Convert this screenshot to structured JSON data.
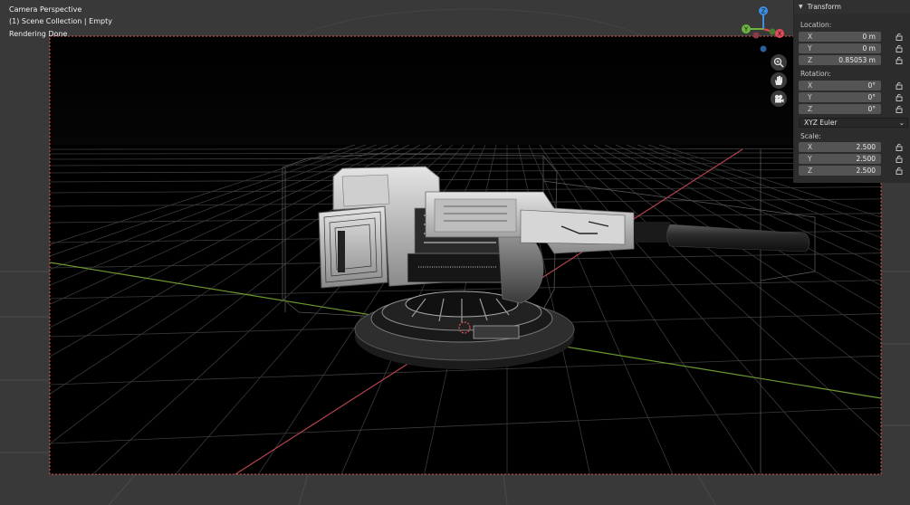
{
  "overlay": {
    "view_name": "Camera Perspective",
    "collection": "(1) Scene Collection | Empty",
    "status": "Rendering Done"
  },
  "gizmo": {
    "axes": [
      "Z",
      "Y",
      "X"
    ],
    "colors": {
      "x": "#e04b5a",
      "y": "#6db33f",
      "z": "#3d8fe0"
    }
  },
  "nav_icons": [
    "zoom-icon",
    "hand-pan-icon",
    "camera-view-icon"
  ],
  "transform": {
    "title": "Transform",
    "location_label": "Location:",
    "location": [
      {
        "axis": "X",
        "value": "0 m"
      },
      {
        "axis": "Y",
        "value": "0 m"
      },
      {
        "axis": "Z",
        "value": "0.85053 m"
      }
    ],
    "rotation_label": "Rotation:",
    "rotation": [
      {
        "axis": "X",
        "value": "0°"
      },
      {
        "axis": "Y",
        "value": "0°"
      },
      {
        "axis": "Z",
        "value": "0°"
      }
    ],
    "rotation_mode": "XYZ Euler",
    "scale_label": "Scale:",
    "scale": [
      {
        "axis": "X",
        "value": "2.500"
      },
      {
        "axis": "Y",
        "value": "2.500"
      },
      {
        "axis": "Z",
        "value": "2.500"
      }
    ]
  },
  "colors": {
    "camera_border": "#d9534f",
    "x_axis_line": "#b8424f",
    "y_axis_line": "#6e9a2e"
  }
}
